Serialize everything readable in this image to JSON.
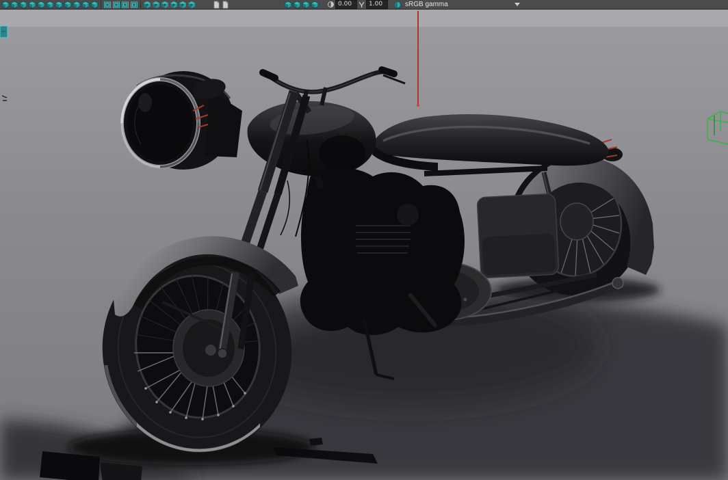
{
  "toolbar": {
    "groups": {
      "camera": [
        "select-camera-icon",
        "lock-camera-icon",
        "camera-attributes-icon",
        "bookmarks-icon",
        "image-plane-icon",
        "pan-zoom-icon",
        "oversan-icon",
        "grease-pencil-icon",
        "grid-icon",
        "film-gate-icon",
        "resolution-gate-icon"
      ],
      "gates": [
        "gate-mask-icon",
        "field-chart-icon",
        "safe-action-icon",
        "safe-title-icon"
      ],
      "display": [
        "wireframe-icon",
        "shaded-icon",
        "textured-icon",
        "use-all-lights-icon",
        "shadows-icon",
        "screen-ao-icon"
      ],
      "frames": [
        "frame-all-icon",
        "frame-selection-icon"
      ],
      "render": [
        "isolate-select-icon",
        "xray-icon",
        "antialias-icon",
        "depth-peel-icon"
      ]
    },
    "exposure_value": "0.00",
    "gamma_value": "1.00",
    "view_transform": "sRGB gamma"
  },
  "colors": {
    "toolbar_bg": "#4b4b4b",
    "icon_teal": "#39b9be",
    "sky": "#a9a9ad",
    "ground": "#8a8a8e",
    "shadow": "#38383c",
    "manipulator_red": "#b23428",
    "light_wire_green": "#3db04c"
  }
}
